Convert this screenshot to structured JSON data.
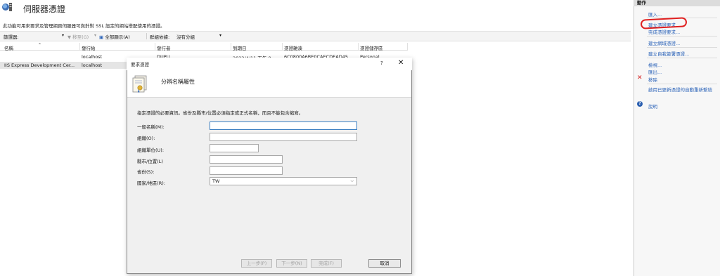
{
  "header": {
    "title": "伺服器憑證",
    "description": "此功能可用來要求及管理網頁伺服器可與針對 SSL 設定的網站搭配使用的憑證。"
  },
  "toolbar": {
    "filter_label": "篩選器:",
    "go_label": "移至(G)",
    "show_all_label": "全部顯示(A)",
    "group_by_label": "群組依據:",
    "group_by_value": "沒有分組"
  },
  "table": {
    "columns": [
      "名稱",
      "發行給",
      "發行者",
      "到期日",
      "憑證雜湊",
      "憑證儲存區"
    ],
    "rows": [
      [
        "",
        "localhost",
        "DUPU",
        "2022/4/11 下午 0...",
        "6C0800A6BE0CAECDEAD45...",
        "Personal"
      ],
      [
        "IIS Express Development Cer...",
        "localhost",
        "",
        "",
        "",
        ""
      ]
    ]
  },
  "actions": {
    "header": "動作",
    "items": [
      "匯入...",
      "建立憑證要求...",
      "完成憑證要求...",
      "建立網域憑證...",
      "建立自我簽署憑證...",
      "檢視...",
      "匯出...",
      "移除",
      "啟用已更新憑證的自動重新繫結",
      "說明"
    ]
  },
  "dialog": {
    "title": "要求憑證",
    "help_glyph": "?",
    "close_glyph": "✕",
    "heading": "分辨名稱屬性",
    "instructions": "指定憑證的必要資訊。省份及縣市/位置必須指定成正式名稱，而且不能包含縮寫。",
    "fields": {
      "common_name_label": "一般名稱(M):",
      "common_name_value": "",
      "org_label": "組織(O):",
      "org_value": "",
      "org_unit_label": "組織單位(U):",
      "org_unit_value": "",
      "city_label": "縣市/位置(L)",
      "city_value": "",
      "state_label": "省份(S):",
      "state_value": "",
      "country_label": "國家/地區(R):",
      "country_value": "TW"
    },
    "buttons": {
      "prev": "上一步(P)",
      "next": "下一步(N)",
      "finish": "完成(F)",
      "cancel": "取消"
    }
  },
  "colors": {
    "accent": "#2a62b8",
    "highlight_circle": "#e02020"
  }
}
